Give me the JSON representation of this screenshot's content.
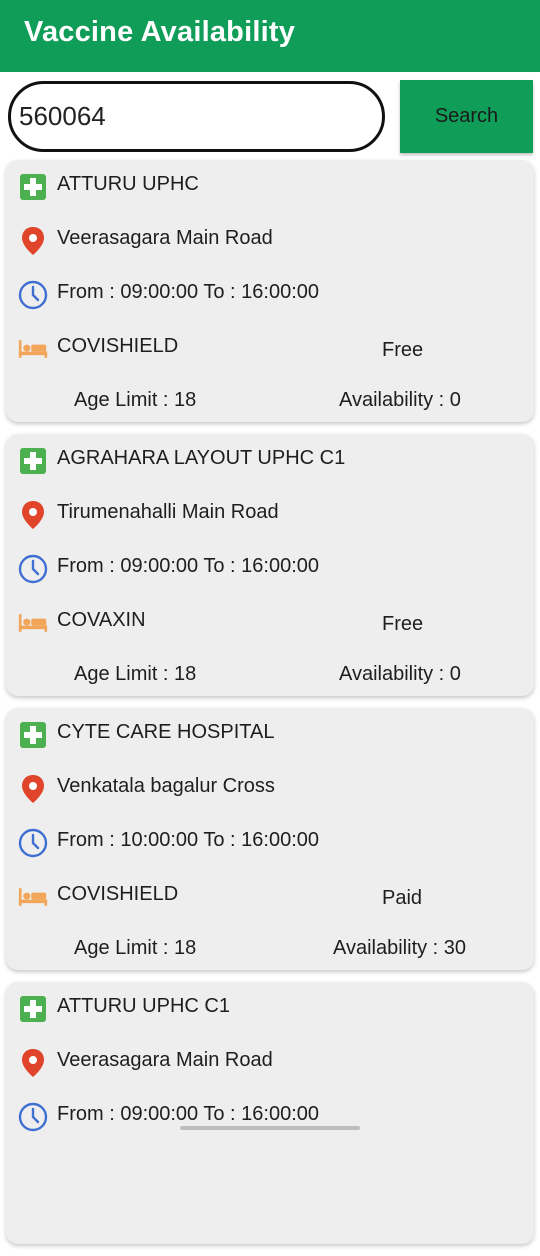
{
  "app": {
    "title": "Vaccine Availability",
    "accent_color": "#0f9d58"
  },
  "search": {
    "value": "560064",
    "button_label": "Search"
  },
  "icons": {
    "hospital": "hospital-plus-icon",
    "location": "location-pin-icon",
    "time": "clock-icon",
    "vaccine": "bed-icon"
  },
  "centers": [
    {
      "name": "ATTURU UPHC",
      "address": "Veerasagara Main Road",
      "timing": "From : 09:00:00 To : 16:00:00",
      "vaccine": "COVISHIELD",
      "fee": "Free",
      "age_limit": "Age Limit : 18",
      "availability": "Availability : 0"
    },
    {
      "name": "AGRAHARA LAYOUT UPHC C1",
      "address": "Tirumenahalli Main Road",
      "timing": "From : 09:00:00 To : 16:00:00",
      "vaccine": "COVAXIN",
      "fee": "Free",
      "age_limit": "Age Limit : 18",
      "availability": "Availability : 0"
    },
    {
      "name": "CYTE CARE HOSPITAL",
      "address": "Venkatala bagalur Cross",
      "timing": "From : 10:00:00 To : 16:00:00",
      "vaccine": "COVISHIELD",
      "fee": "Paid",
      "age_limit": "Age Limit : 18",
      "availability": "Availability : 30"
    },
    {
      "name": "ATTURU UPHC C1",
      "address": "Veerasagara Main Road",
      "timing": "From : 09:00:00 To : 16:00:00"
    }
  ]
}
